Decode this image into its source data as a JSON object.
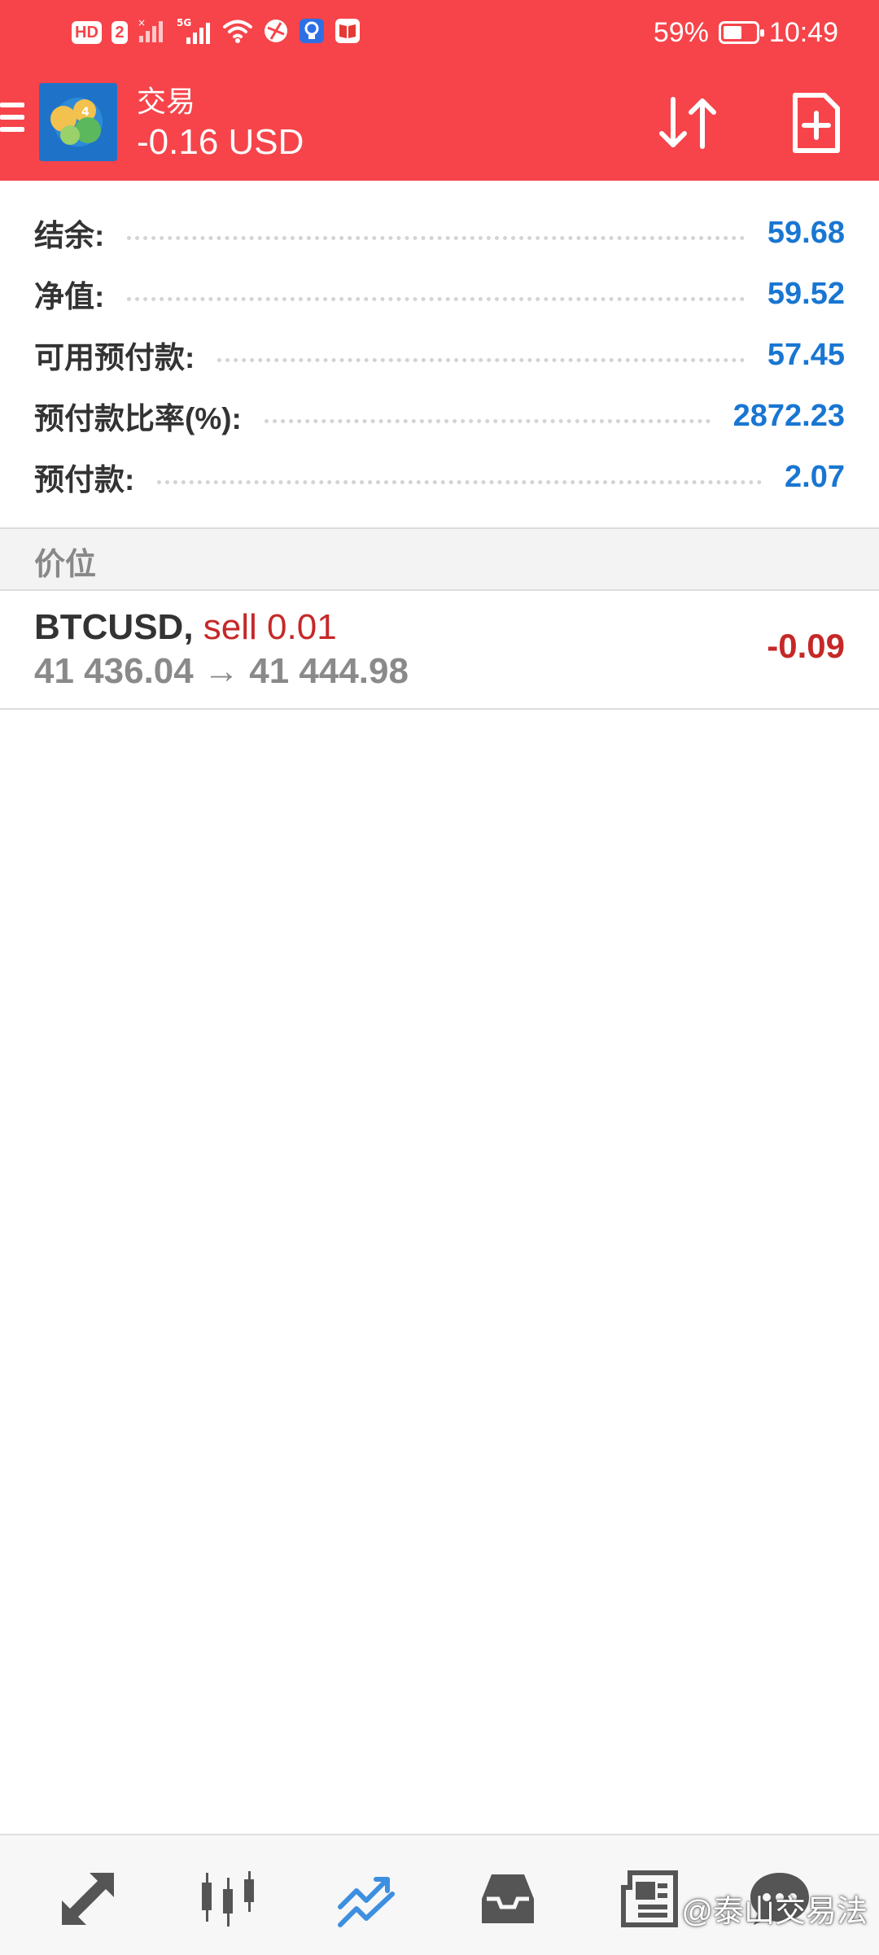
{
  "status_bar": {
    "network_badges": [
      "HD",
      "2"
    ],
    "signal_label": "5G",
    "battery_percent": "59%",
    "battery_level": 0.59,
    "time": "10:49"
  },
  "app_bar": {
    "title": "交易",
    "balance_change": "-0.16 USD",
    "icons": [
      "menu-icon",
      "app-logo",
      "sort-icon",
      "new-order-icon"
    ]
  },
  "account": {
    "rows": [
      {
        "label": "结余:",
        "value": "59.68"
      },
      {
        "label": "净值:",
        "value": "59.52"
      },
      {
        "label": "可用预付款:",
        "value": "57.45"
      },
      {
        "label": "预付款比率(%):",
        "value": "2872.23"
      },
      {
        "label": "预付款:",
        "value": "2.07"
      }
    ]
  },
  "positions": {
    "section_title": "价位",
    "items": [
      {
        "symbol": "BTCUSD",
        "separator": ",",
        "side": "sell 0.01",
        "price_open": "41 436.04",
        "arrow": "→",
        "price_current": "41 444.98",
        "profit": "-0.09"
      }
    ]
  },
  "bottom_nav": {
    "items": [
      "quotes-icon",
      "chart-icon",
      "trade-icon",
      "history-icon",
      "news-icon",
      "chat-icon"
    ],
    "active": "trade-icon"
  },
  "watermark": "@泰山交易法",
  "colors": {
    "header": "#f6444a",
    "value_blue": "#1976d2",
    "loss_red": "#c62828",
    "active_nav": "#3d8fe0"
  }
}
